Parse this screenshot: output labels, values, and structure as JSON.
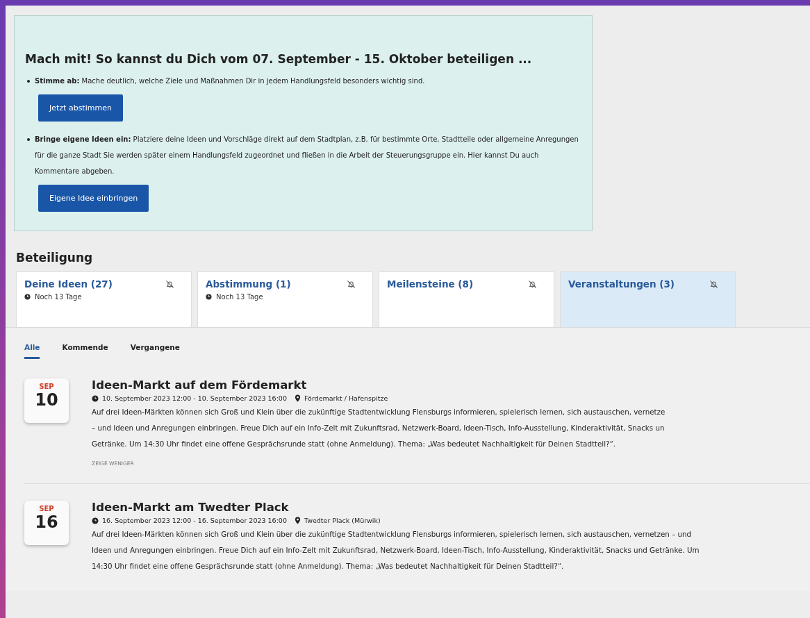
{
  "intro": {
    "title": "Mach mit! So kannst du Dich vom 07. September - 15. Oktober beteiligen ...",
    "items": [
      {
        "lead": "Stimme ab:",
        "text": "Mache deutlich, welche Ziele und Maßnahmen Dir in jedem Handlungsfeld besonders wichtig sind.",
        "button": "Jetzt abstimmen"
      },
      {
        "lead": "Bringe eigene Ideen ein:",
        "text": "Platziere deine Ideen und Vorschläge direkt auf dem Stadtplan, z.B. für bestimmte Orte, Stadtteile oder allgemeine Anregungen für die ganze Stadt Sie werden später einem Handlungsfeld zugeordnet und fließen in die Arbeit der Steuerungsgruppe ein. Hier kannst Du auch Kommentare abgeben.",
        "button": "Eigene Idee einbringen"
      }
    ]
  },
  "section_title": "Beteiligung",
  "tabs": [
    {
      "label": "Deine Ideen (27)",
      "deadline": "Noch 13 Tage",
      "selected": false
    },
    {
      "label": "Abstimmung (1)",
      "deadline": "Noch 13 Tage",
      "selected": false
    },
    {
      "label": "Meilensteine (8)",
      "selected": false
    },
    {
      "label": "Veranstaltungen (3)",
      "selected": true
    }
  ],
  "filters": [
    {
      "label": "Alle",
      "selected": true
    },
    {
      "label": "Kommende",
      "selected": false
    },
    {
      "label": "Vergangene",
      "selected": false
    }
  ],
  "events": [
    {
      "month": "SEP",
      "day": "10",
      "title": "Ideen-Markt auf dem Fördemarkt",
      "time": "10. September 2023 12:00 - 10. September 2023 16:00",
      "place": "Fördemarkt / Hafenspitze",
      "lines": [
        "Auf drei Ideen-Märkten können sich Groß und Klein über die zukünftige Stadtentwicklung Flensburgs informieren, spielerisch lernen, sich austauschen, vernetze",
        "– und Ideen und Anregungen einbringen. Freue Dich auf ein Info-Zelt mit Zukunftsrad, Netzwerk-Board, Ideen-Tisch, Info-Ausstellung, Kinderaktivität, Snacks un",
        "Getränke. Um 14:30 Uhr findet eine offene Gesprächsrunde statt (ohne Anmeldung). Thema: „Was bedeutet Nachhaltigkeit für Deinen Stadtteil?“."
      ],
      "toggle": "ZEIGE WENIGER"
    },
    {
      "month": "SEP",
      "day": "16",
      "title": "Ideen-Markt am Twedter Plack",
      "time": "16. September 2023 12:00 - 16. September 2023 16:00",
      "place": "Twedter Plack (Mürwik)",
      "lines": [
        "Auf drei Ideen-Märkten können sich Groß und Klein über die zukünftige Stadtentwicklung Flensburgs informieren, spielerisch lernen, sich austauschen, vernetzen – und",
        "Ideen und Anregungen einbringen. Freue Dich auf ein Info-Zelt mit Zukunftsrad, Netzwerk-Board, Ideen-Tisch, Info-Ausstellung, Kinderaktivität, Snacks und Getränke. Um",
        "14:30 Uhr findet eine offene Gesprächsrunde statt (ohne Anmeldung). Thema: „Was bedeutet Nachhaltigkeit für Deinen Stadtteil?“."
      ]
    }
  ]
}
